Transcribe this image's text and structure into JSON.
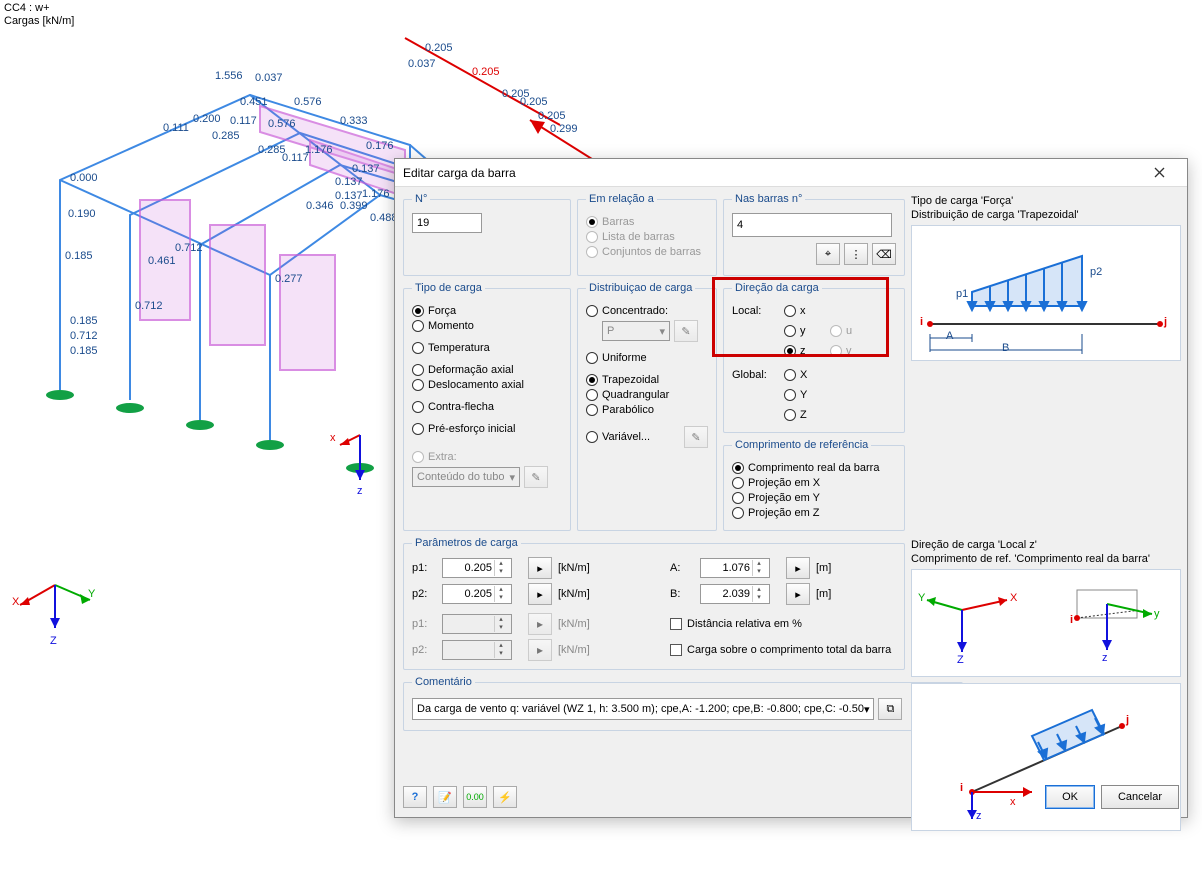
{
  "bg": {
    "line1": "CC4 : w+",
    "line2": "Cargas [kN/m]"
  },
  "axis_main": {
    "x": "X",
    "y": "Y",
    "z": "Z"
  },
  "axis_small": {
    "x": "x",
    "z": "z"
  },
  "model_values": [
    "0.205",
    "0.205",
    "0.205",
    "0.205",
    "0.205",
    "0.299",
    "1.556",
    "0.037",
    "0.037",
    "0.451",
    "0.576",
    "0.285",
    "0.333",
    "0.117",
    "0.576",
    "0.117",
    "1.176",
    "0.137",
    "0.137",
    "0.285",
    "0.399",
    "0.137",
    "0.488",
    "0.346",
    "0.176",
    "0.200",
    "0.111",
    "1.176",
    "0.000",
    "0.190",
    "0.185",
    "0.712",
    "0.461",
    "0.712",
    "0.185",
    "0.277",
    "0.712",
    "0.185"
  ],
  "dialog": {
    "title": "Editar carga da barra",
    "numero": {
      "label": "N°",
      "value": "19"
    },
    "relacao": {
      "label": "Em relação a",
      "opts": [
        "Barras",
        "Lista de barras",
        "Conjuntos de barras"
      ],
      "sel": 0
    },
    "nas_barras": {
      "label": "Nas barras n°",
      "value": "4"
    },
    "tipo_carga": {
      "label": "Tipo de carga",
      "opts": [
        "Força",
        "Momento",
        "Temperatura",
        "Deformação axial",
        "Deslocamento axial",
        "Contra-flecha",
        "Pré-esforço inicial"
      ],
      "sel": 0,
      "extra_label": "Extra:",
      "extra_combo": "Conteúdo do tubo"
    },
    "distribuicao": {
      "label": "Distribuiçao de carga",
      "opts": [
        "Concentrado:",
        "Uniforme",
        "Trapezoidal",
        "Quadrangular",
        "Parabólico",
        "Variável..."
      ],
      "sel": 2,
      "concentrado_combo": "P"
    },
    "direcao": {
      "label": "Direção da carga",
      "local_label": "Local:",
      "global_label": "Global:",
      "local": [
        "x",
        "y",
        "z",
        "u",
        "v"
      ],
      "local_sel": 2,
      "global": [
        "X",
        "Y",
        "Z"
      ],
      "global_sel": -1
    },
    "comp_ref": {
      "label": "Comprimento de referência",
      "opts": [
        "Comprimento real da barra",
        "Projeção em X",
        "Projeção em Y",
        "Projeção em Z"
      ],
      "sel": 0
    },
    "params": {
      "label": "Parâmetros de carga",
      "rows": [
        {
          "name": "p1:",
          "value": "0.205",
          "unit": "[kN/m]"
        },
        {
          "name": "p2:",
          "value": "0.205",
          "unit": "[kN/m]"
        }
      ],
      "rows_gray": [
        {
          "name": "p1:",
          "value": "",
          "unit": "[kN/m]"
        },
        {
          "name": "p2:",
          "value": "",
          "unit": "[kN/m]"
        }
      ],
      "A": {
        "name": "A:",
        "value": "1.076",
        "unit": "[m]"
      },
      "B": {
        "name": "B:",
        "value": "2.039",
        "unit": "[m]"
      },
      "chk1": "Distância relativa em %",
      "chk2": "Carga sobre o comprimento total da barra"
    },
    "comentario": {
      "label": "Comentário",
      "value": "Da carga de vento q: variável (WZ 1, h: 3.500 m); cpe,A: -1.200; cpe,B: -0.800; cpe,C: -0.50"
    },
    "preview_top": {
      "l1": "Tipo de carga 'Força'",
      "l2": "Distribuição de carga 'Trapezoidal'",
      "p1": "p1",
      "p2": "p2",
      "A": "A",
      "B": "B",
      "i": "i",
      "j": "j"
    },
    "preview_bottom": {
      "l1": "Direção de carga 'Local z'",
      "l2": "Comprimento de ref. 'Comprimento real da barra'",
      "X": "X",
      "Y": "Y",
      "Z": "Z",
      "x": "x",
      "y": "y",
      "z": "z",
      "i": "i",
      "j": "j"
    },
    "buttons": {
      "ok": "OK",
      "cancel": "Cancelar"
    }
  }
}
